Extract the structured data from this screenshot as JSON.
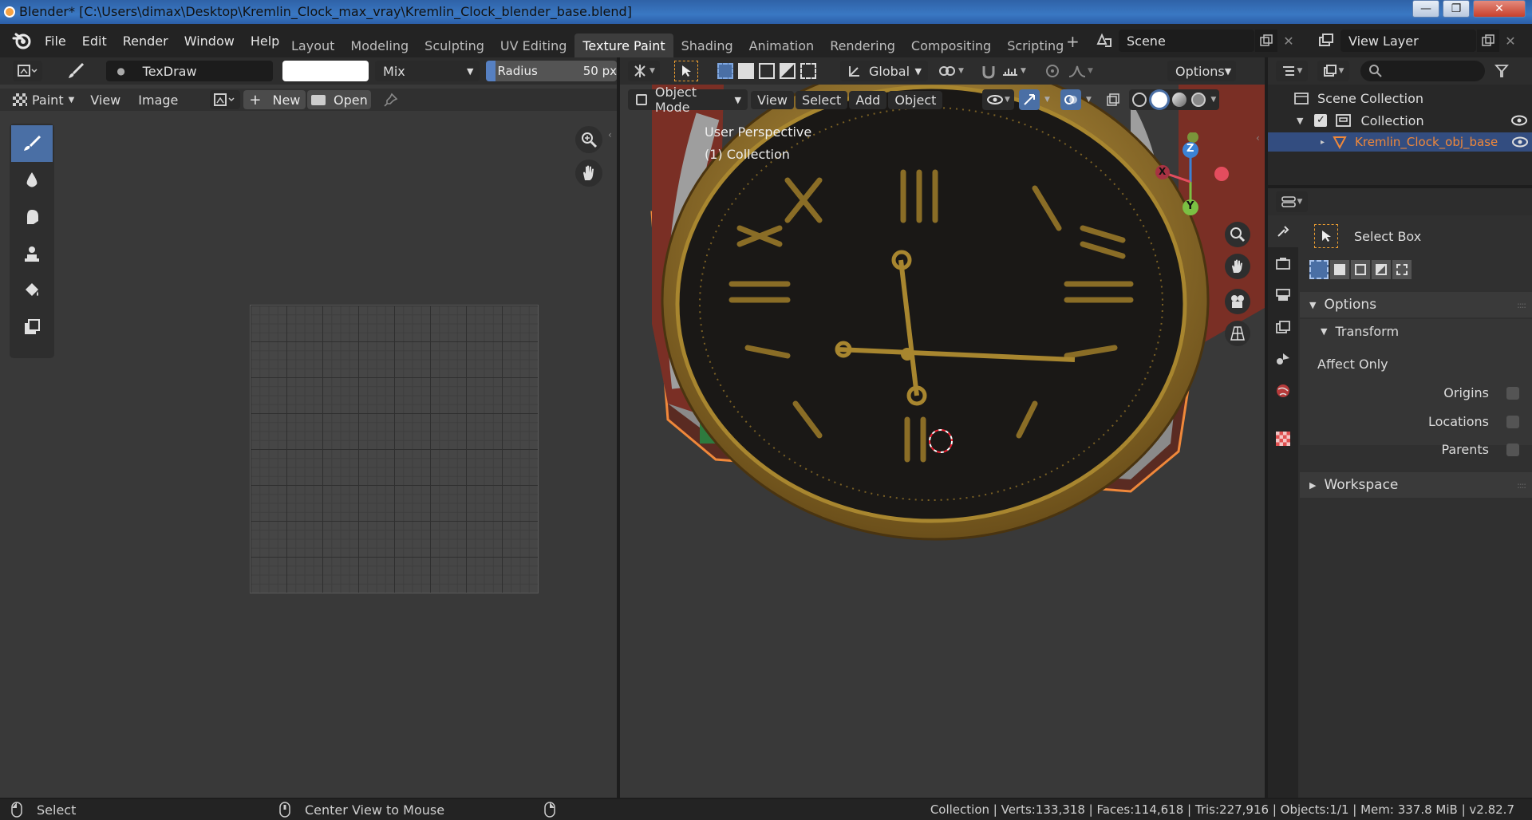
{
  "window": {
    "title": "Blender* [C:\\Users\\dimax\\Desktop\\Kremlin_Clock_max_vray\\Kremlin_Clock_blender_base.blend]",
    "min": "—",
    "max": "❐",
    "close": "✕"
  },
  "menu": {
    "file": "File",
    "edit": "Edit",
    "render": "Render",
    "window": "Window",
    "help": "Help"
  },
  "workspaces": [
    "Layout",
    "Modeling",
    "Sculpting",
    "UV Editing",
    "Texture Paint",
    "Shading",
    "Animation",
    "Rendering",
    "Compositing",
    "Scripting"
  ],
  "active_workspace": "Texture Paint",
  "add_tab": "+",
  "scene": {
    "value": "Scene"
  },
  "view_layer": {
    "value": "View Layer"
  },
  "image_editor": {
    "brush_name": "TexDraw",
    "blend_mode": "Mix",
    "radius_label": "Radius",
    "radius_value": "50 px",
    "paint_mode": "Paint",
    "view": "View",
    "image": "Image",
    "new_label": "New",
    "open_label": "Open"
  },
  "viewport": {
    "transform_orientation": "Global",
    "options": "Options",
    "mode": "Object Mode",
    "view": "View",
    "select": "Select",
    "add": "Add",
    "object": "Object",
    "overlay_title": "User Perspective",
    "overlay_collection": "(1) Collection",
    "gizmo": {
      "x": "X",
      "y": "Y",
      "z": "Z"
    }
  },
  "outliner": {
    "scene_collection": "Scene Collection",
    "collection": "Collection",
    "object": "Kremlin_Clock_obj_base"
  },
  "properties": {
    "tool_name": "Select Box",
    "options_header": "Options",
    "transform_header": "Transform",
    "affect_only": "Affect Only",
    "origins": "Origins",
    "locations": "Locations",
    "parents": "Parents",
    "workspace_header": "Workspace"
  },
  "status": {
    "left_action": "Select",
    "middle_action": "Center View to Mouse",
    "stats": "Collection | Verts:133,318 | Faces:114,618 | Tris:227,916 | Objects:1/1 | Mem: 337.8 MiB | v2.82.7"
  },
  "colors": {
    "accent": "#4a6fa5",
    "selected_object": "#f0883a",
    "background": "#1d1d1d",
    "panel": "#303030",
    "viewport": "#393939"
  }
}
